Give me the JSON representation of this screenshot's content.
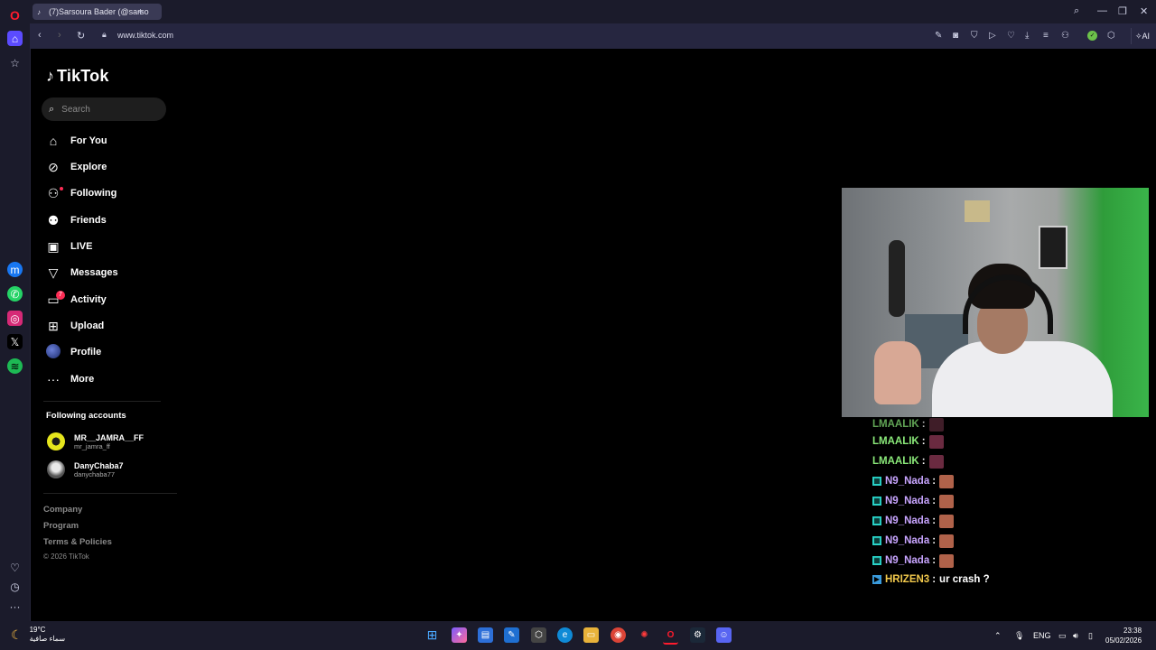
{
  "browser": {
    "tab_title": "(7)Sarsoura Bader (@sarso",
    "url": "www.tiktok.com",
    "ai_label": "AI"
  },
  "tiktok": {
    "logo_text": "TikTok",
    "search_placeholder": "Search",
    "menu": [
      {
        "label": "For You",
        "icon": "home-icon"
      },
      {
        "label": "Explore",
        "icon": "compass-icon"
      },
      {
        "label": "Following",
        "icon": "user-plus-icon"
      },
      {
        "label": "Friends",
        "icon": "users-icon"
      },
      {
        "label": "LIVE",
        "icon": "live-icon"
      },
      {
        "label": "Messages",
        "icon": "send-icon"
      },
      {
        "label": "Activity",
        "icon": "inbox-icon",
        "badge": "7"
      },
      {
        "label": "Upload",
        "icon": "plus-square-icon"
      },
      {
        "label": "Profile",
        "icon": "avatar-icon"
      },
      {
        "label": "More",
        "icon": "more-dots-icon"
      }
    ],
    "following_title": "Following accounts",
    "accounts": [
      {
        "name": "MR__JAMRA__FF",
        "handle": "mr_jamra_ff"
      },
      {
        "name": "DanyChaba7",
        "handle": "danychaba77"
      }
    ],
    "footer": [
      "Company",
      "Program",
      "Terms & Policies"
    ],
    "copyright": "© 2026 TikTok"
  },
  "chat": [
    {
      "user": "LMAALIK",
      "color": "#8bea7a",
      "emote": true
    },
    {
      "user": "LMAALIK",
      "color": "#8bea7a",
      "emote": true
    },
    {
      "user": "LMAALIK",
      "color": "#8bea7a",
      "emote": true
    },
    {
      "user": "N9_Nada",
      "color": "#c8a5ff",
      "emote": true
    },
    {
      "user": "N9_Nada",
      "color": "#c8a5ff",
      "emote": true
    },
    {
      "user": "N9_Nada",
      "color": "#c8a5ff",
      "emote": true
    },
    {
      "user": "N9_Nada",
      "color": "#c8a5ff",
      "emote": true
    },
    {
      "user": "N9_Nada",
      "color": "#c8a5ff",
      "emote": true
    },
    {
      "user": "HRIZEN3",
      "color": "#f2c94c",
      "message": "ur crash ?"
    }
  ],
  "taskbar": {
    "weather_temp": "19°C",
    "weather_desc": "سماء صافية",
    "lang": "ENG",
    "time": "23:38",
    "date": "05/02/2026"
  },
  "colors": {
    "accent": "#fe2c55",
    "browser_bg": "#1b1b2b"
  }
}
